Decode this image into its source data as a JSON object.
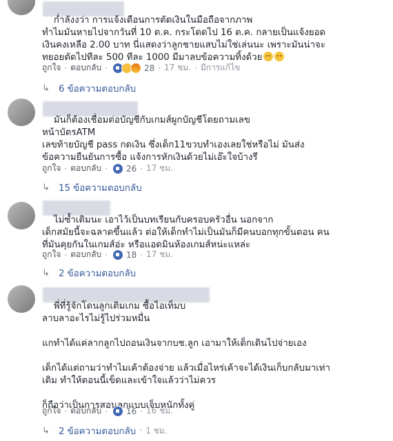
{
  "comments": [
    {
      "text": "ก่ำลังงว่า การแจ้งเตือนการตัดเงินในมือถือจากภาพ\nทำไมมันหายไปจากวันที่ 10 ต.ค. กระโดดไป 16 ต.ค. กลายเป็นแจ้งยอด\nเงินคงเหลือ 2.00 บาท นี่แสดงว่าลูกชายแสบไม่ใช่เล่นนะ เพราะมันน่าจะ\nทยอยตัดไปทีละ 500 ทีละ 1000 มีมาลบข้อความทิ้งด้วย",
      "like_label": "ถูกใจ",
      "reply_label": "ตอบกลับ",
      "reaction_count": "28",
      "time": "17 ชม.",
      "edited": "มีการแก้ไข",
      "replies_label": "6 ข้อความตอบกลับ"
    },
    {
      "text": "มันก็ต้องเชื่อมต่อบัญชีกับเกมส์ผูกบัญชีโดยถามเลข\nหน้าบัตรATM\nเลขท้ายบัญชี pass กดเงิน ซึ่งเด็ก11ขวบทำเองเลยใช่หรือไม่ มันส่ง\nข้อความยืนยันการซื้อ แจ้งการหักเงินด้วยไม่เอ๊ะใจบ้างรึ",
      "like_label": "ถูกใจ",
      "reply_label": "ตอบกลับ",
      "reaction_count": "26",
      "time": "17 ชม.",
      "replies_label": "15 ข้อความตอบกลับ"
    },
    {
      "text": "ไม่ซ้ำเติมนะ เอาไว้เป็นบทเรียนกับครอบครัวอื่น นอกจาก\nเด็กสมัยนี้จะฉลาดขึ้นแล้ว ต่อให้เด็กทำไม่เป็นมันก็มีคนบอกทุกขั้นตอน คน\nที่มันคุยกันในเกมส์อ่ะ หรือแอดมินห้องเกมส์หน่ะแหล่ะ",
      "like_label": "ถูกใจ",
      "reply_label": "ตอบกลับ",
      "reaction_count": "18",
      "time": "17 ชม.",
      "replies_label": "2 ข้อความตอบกลับ"
    },
    {
      "text": "พี่ที่รู้จักโดนลูกเติมเกม ซื้อไอเท็มบ\nลาบลาอะไรไม่รู้ไปร่วมหมื่น\n\nแกทำได้แค่ลากลูกไปถอนเงินจากบช.ลูก เอามาให้เด็กเดินไปจ่ายเอง\n\nเด็กได้แต่ถามว่าทำไมเค้าต้องจ่าย แล้วเมื่อไหร่เค้าจะได้เงินเก็บกลับมาเท่า\nเดิม ทำให้ตอนนี้เข็ดและเข้าใจแล้วว่าไม่ควร\n\nก็ถือว่าเป็นการสอนลูกแบบเจ็บหนักทั้งคู่",
      "like_label": "ถูกใจ",
      "reply_label": "ตอบกลับ",
      "reaction_count": "16",
      "time": "16 ชม.",
      "replies_label": "2 ข้อความตอบกลับ",
      "replies_time": "1 ชม."
    }
  ],
  "icons": {
    "reply_arrow": "reply-arrow-icon",
    "like": "like-reaction-icon",
    "haha": "haha-reaction-icon",
    "angry": "angry-reaction-icon",
    "emoji": "face-emoji-icon"
  },
  "colors": {
    "link": "#365899",
    "meta": "#90949c",
    "like_blue": "#4267b2"
  }
}
